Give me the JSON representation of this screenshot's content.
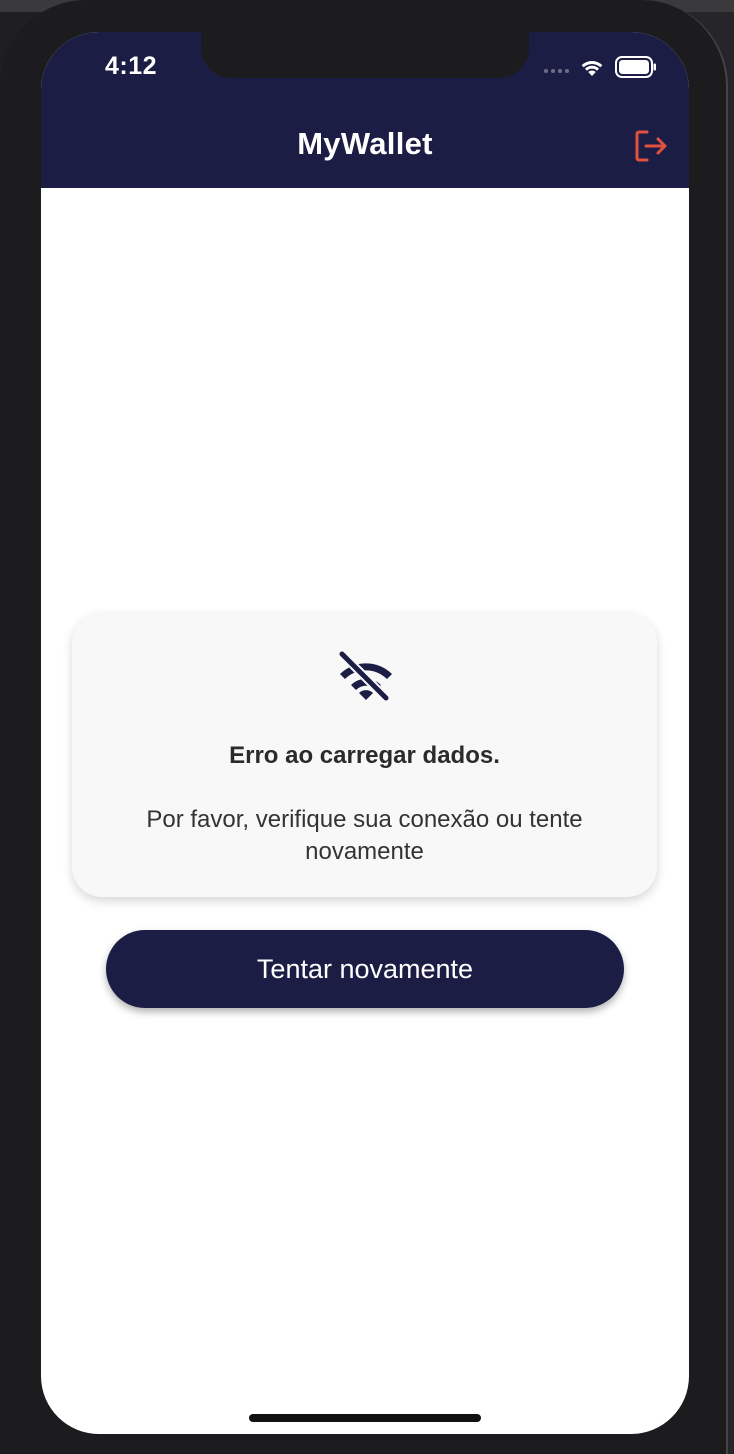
{
  "status_bar": {
    "time": "4:12"
  },
  "app_bar": {
    "title": "MyWallet",
    "logout_icon": "logout-icon"
  },
  "error_card": {
    "icon": "wifi-off-icon",
    "title": "Erro ao carregar dados.",
    "message": "Por favor, verifique sua conexão ou tente novamente"
  },
  "retry_button": {
    "label": "Tentar novamente"
  },
  "colors": {
    "primary": "#1c1d45",
    "logout_accent": "#e2503f",
    "card_bg": "#f8f8f8"
  }
}
